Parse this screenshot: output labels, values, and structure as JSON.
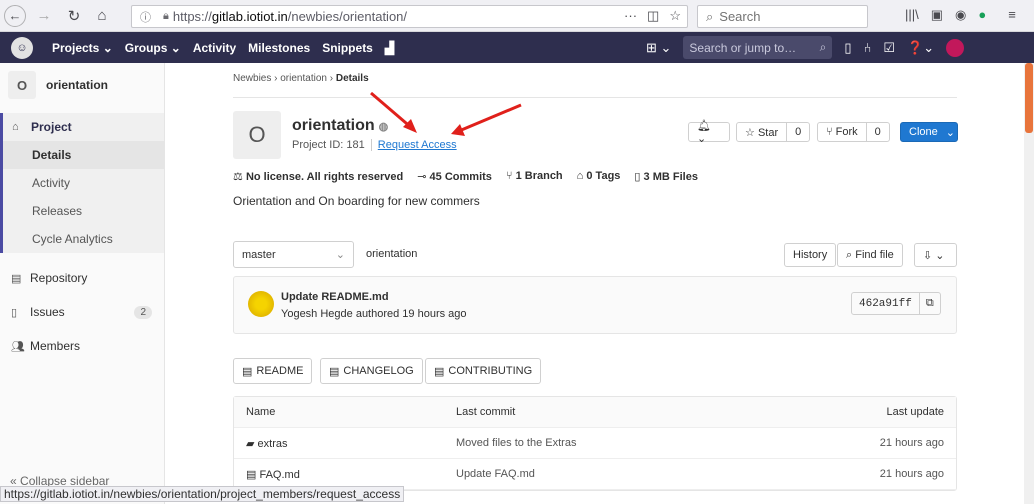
{
  "browser": {
    "url_scheme": "https://",
    "url_host": "gitlab.iotiot.in",
    "url_path": "/newbies/orientation/",
    "search_placeholder": "Search",
    "status_url": "https://gitlab.iotiot.in/newbies/orientation/project_members/request_access"
  },
  "header": {
    "nav": [
      "Projects ⌄",
      "Groups ⌄",
      "Activity",
      "Milestones",
      "Snippets"
    ],
    "search_placeholder": "Search or jump to…"
  },
  "sidebar": {
    "project_initial": "O",
    "project_name": "orientation",
    "project_label": "Project",
    "sub_items": [
      "Details",
      "Activity",
      "Releases",
      "Cycle Analytics"
    ],
    "repository": "Repository",
    "issues": "Issues",
    "issues_count": "2",
    "members": "Members",
    "collapse": "Collapse sidebar"
  },
  "breadcrumb": {
    "group": "Newbies",
    "project": "orientation",
    "current": "Details"
  },
  "project": {
    "initial": "O",
    "name": "orientation",
    "id_text": "Project ID: 181",
    "request_access": "Request Access",
    "star_label": "Star",
    "star_count": "0",
    "fork_label": "Fork",
    "fork_count": "0",
    "clone_label": "Clone",
    "license": "No license. All rights reserved",
    "commits": "45 Commits",
    "branch": "1 Branch",
    "tags": "0 Tags",
    "files": "3 MB Files",
    "description": "Orientation and On boarding for new commers"
  },
  "repo": {
    "branch": "master",
    "path": "orientation",
    "history": "History",
    "find_file": "Find file"
  },
  "commit": {
    "title": "Update README.md",
    "author_line": "Yogesh Hegde authored 19 hours ago",
    "sha": "462a91ff"
  },
  "docs": [
    "README",
    "CHANGELOG",
    "CONTRIBUTING"
  ],
  "files": {
    "headers": [
      "Name",
      "Last commit",
      "Last update"
    ],
    "rows": [
      {
        "name": "extras",
        "commit": "Moved files to the Extras",
        "updated": "21 hours ago"
      },
      {
        "name": "FAQ.md",
        "commit": "Update FAQ.md",
        "updated": "21 hours ago"
      }
    ]
  }
}
